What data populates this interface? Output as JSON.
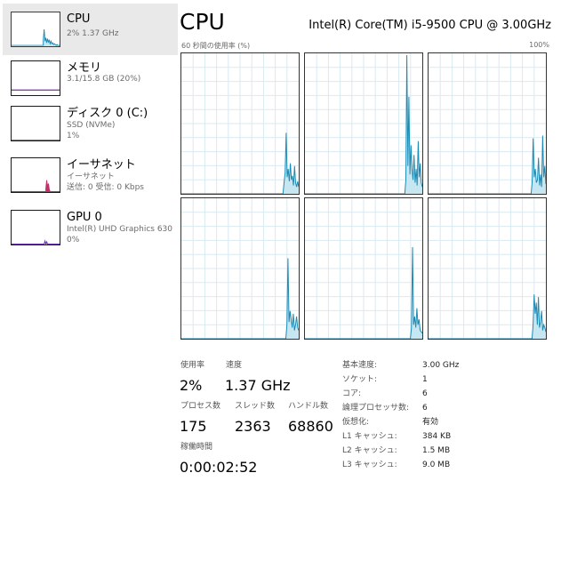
{
  "sidebar": {
    "items": [
      {
        "title": "CPU",
        "sub1": "2%  1.37 GHz",
        "sub2": "",
        "sub3": ""
      },
      {
        "title": "メモリ",
        "sub1": "3.1/15.8 GB (20%)",
        "sub2": "",
        "sub3": ""
      },
      {
        "title": "ディスク 0 (C:)",
        "sub1": "SSD (NVMe)",
        "sub2": "1%",
        "sub3": ""
      },
      {
        "title": "イーサネット",
        "sub1": "イーサネット",
        "sub2": "送信: 0 受信: 0 Kbps",
        "sub3": ""
      },
      {
        "title": "GPU 0",
        "sub1": "Intel(R) UHD Graphics 630",
        "sub2": "0%",
        "sub3": ""
      }
    ]
  },
  "header": {
    "title": "CPU",
    "model": "Intel(R) Core(TM) i5-9500 CPU @ 3.00GHz",
    "graph_caption": "60 秒間の使用率 (%)",
    "graph_max": "100%"
  },
  "stats": {
    "utilization_label": "使用率",
    "utilization": "2%",
    "speed_label": "速度",
    "speed": "1.37 GHz",
    "processes_label": "プロセス数",
    "processes": "175",
    "threads_label": "スレッド数",
    "threads": "2363",
    "handles_label": "ハンドル数",
    "handles": "68860",
    "uptime_label": "稼働時間",
    "uptime": "0:00:02:52"
  },
  "specs": [
    {
      "key": "基本速度:",
      "value": "3.00 GHz"
    },
    {
      "key": "ソケット:",
      "value": "1"
    },
    {
      "key": "コア:",
      "value": "6"
    },
    {
      "key": "論理プロセッサ数:",
      "value": "6"
    },
    {
      "key": "仮想化:",
      "value": "有効"
    },
    {
      "key": "L1 キャッシュ:",
      "value": "384 KB"
    },
    {
      "key": "L2 キャッシュ:",
      "value": "1.5 MB"
    },
    {
      "key": "L3 キャッシュ:",
      "value": "9.0 MB"
    }
  ],
  "colors": {
    "cpu_line": "#1e8bb4",
    "cpu_fill": "#c6e6f2",
    "memory_line": "#8b3fa8",
    "disk_line": "#4da033",
    "ethernet_line": "#c0306b",
    "gpu_line": "#6e3fb0",
    "grid": "#d9eaf2"
  },
  "core_graphs": [
    {
      "name": "cpu-core-0",
      "samples": [
        0,
        0,
        0,
        0,
        0,
        0,
        0,
        0,
        0,
        0,
        0,
        0,
        0,
        0,
        0,
        0,
        0,
        0,
        0,
        0,
        0,
        0,
        0,
        0,
        0,
        0,
        0,
        0,
        0,
        0,
        0,
        0,
        0,
        0,
        0,
        0,
        0,
        0,
        0,
        0,
        0,
        0,
        0,
        0,
        0,
        0,
        0,
        0,
        0,
        0,
        0,
        0,
        0,
        0,
        0,
        0,
        0,
        0,
        0,
        0,
        0,
        0,
        0,
        0,
        0,
        0,
        0,
        0,
        0,
        0,
        0,
        0,
        0,
        0,
        0,
        0,
        0,
        0,
        0,
        0,
        0,
        0,
        0,
        0,
        0,
        0,
        0,
        0,
        0,
        0,
        0,
        0,
        0,
        0,
        0,
        0,
        0,
        0,
        8,
        15,
        44,
        12,
        18,
        9,
        22,
        10,
        13,
        6,
        20,
        8,
        5,
        9,
        5
      ]
    },
    {
      "name": "cpu-core-1",
      "samples": [
        0,
        0,
        0,
        0,
        0,
        0,
        0,
        0,
        0,
        0,
        0,
        0,
        0,
        0,
        0,
        0,
        0,
        0,
        0,
        0,
        0,
        0,
        0,
        0,
        0,
        0,
        0,
        0,
        0,
        0,
        0,
        0,
        0,
        0,
        0,
        0,
        0,
        0,
        0,
        0,
        0,
        0,
        0,
        0,
        0,
        0,
        0,
        0,
        0,
        0,
        0,
        0,
        0,
        0,
        0,
        0,
        0,
        0,
        0,
        0,
        0,
        0,
        0,
        0,
        0,
        0,
        0,
        0,
        0,
        0,
        0,
        0,
        0,
        0,
        0,
        0,
        0,
        0,
        0,
        0,
        0,
        0,
        0,
        0,
        0,
        0,
        0,
        0,
        0,
        0,
        0,
        0,
        0,
        0,
        0,
        0,
        0,
        0,
        10,
        100,
        20,
        70,
        14,
        35,
        18,
        10,
        28,
        8,
        18,
        6,
        38,
        12,
        22,
        8,
        5
      ]
    },
    {
      "name": "cpu-core-2",
      "samples": [
        0,
        0,
        0,
        0,
        0,
        0,
        0,
        0,
        0,
        0,
        0,
        0,
        0,
        0,
        0,
        0,
        0,
        0,
        0,
        0,
        0,
        0,
        0,
        0,
        0,
        0,
        0,
        0,
        0,
        0,
        0,
        0,
        0,
        0,
        0,
        0,
        0,
        0,
        0,
        0,
        0,
        0,
        0,
        0,
        0,
        0,
        0,
        0,
        0,
        0,
        0,
        0,
        0,
        0,
        0,
        0,
        0,
        0,
        0,
        0,
        0,
        0,
        0,
        0,
        0,
        0,
        0,
        0,
        0,
        0,
        0,
        0,
        0,
        0,
        0,
        0,
        0,
        0,
        0,
        0,
        0,
        0,
        0,
        0,
        0,
        0,
        0,
        0,
        0,
        0,
        0,
        0,
        0,
        0,
        0,
        0,
        0,
        0,
        8,
        40,
        12,
        18,
        8,
        10,
        26,
        6,
        14,
        5,
        42,
        12,
        20,
        7
      ]
    },
    {
      "name": "cpu-core-3",
      "samples": [
        0,
        0,
        0,
        0,
        0,
        0,
        0,
        0,
        0,
        0,
        0,
        0,
        0,
        0,
        0,
        0,
        0,
        0,
        0,
        0,
        0,
        0,
        0,
        0,
        0,
        0,
        0,
        0,
        0,
        0,
        0,
        0,
        0,
        0,
        0,
        0,
        0,
        0,
        0,
        0,
        0,
        0,
        0,
        0,
        0,
        0,
        0,
        0,
        0,
        0,
        0,
        0,
        0,
        0,
        0,
        0,
        0,
        0,
        0,
        0,
        0,
        0,
        0,
        0,
        0,
        0,
        0,
        0,
        0,
        0,
        0,
        0,
        0,
        0,
        0,
        0,
        0,
        0,
        0,
        0,
        0,
        0,
        0,
        0,
        0,
        0,
        0,
        0,
        0,
        0,
        0,
        0,
        0,
        0,
        0,
        0,
        0,
        0,
        10,
        58,
        12,
        20,
        14,
        8,
        18,
        6,
        10,
        16,
        8,
        6
      ]
    },
    {
      "name": "cpu-core-4",
      "samples": [
        0,
        0,
        0,
        0,
        0,
        0,
        0,
        0,
        0,
        0,
        0,
        0,
        0,
        0,
        0,
        0,
        0,
        0,
        0,
        0,
        0,
        0,
        0,
        0,
        0,
        0,
        0,
        0,
        0,
        0,
        0,
        0,
        0,
        0,
        0,
        0,
        0,
        0,
        0,
        0,
        0,
        0,
        0,
        0,
        0,
        0,
        0,
        0,
        0,
        0,
        0,
        0,
        0,
        0,
        0,
        0,
        0,
        0,
        0,
        0,
        0,
        0,
        0,
        0,
        0,
        0,
        0,
        0,
        0,
        0,
        0,
        0,
        0,
        0,
        0,
        0,
        0,
        0,
        0,
        0,
        0,
        0,
        0,
        0,
        0,
        0,
        0,
        0,
        0,
        0,
        0,
        0,
        0,
        0,
        0,
        0,
        0,
        0,
        8,
        66,
        10,
        16,
        8,
        22,
        10,
        14,
        6,
        5,
        4
      ]
    },
    {
      "name": "cpu-core-5",
      "samples": [
        0,
        0,
        0,
        0,
        0,
        0,
        0,
        0,
        0,
        0,
        0,
        0,
        0,
        0,
        0,
        0,
        0,
        0,
        0,
        0,
        0,
        0,
        0,
        0,
        0,
        0,
        0,
        0,
        0,
        0,
        0,
        0,
        0,
        0,
        0,
        0,
        0,
        0,
        0,
        0,
        0,
        0,
        0,
        0,
        0,
        0,
        0,
        0,
        0,
        0,
        0,
        0,
        0,
        0,
        0,
        0,
        0,
        0,
        0,
        0,
        0,
        0,
        0,
        0,
        0,
        0,
        0,
        0,
        0,
        0,
        0,
        0,
        0,
        0,
        0,
        0,
        0,
        0,
        0,
        0,
        0,
        0,
        0,
        0,
        0,
        0,
        0,
        0,
        0,
        0,
        0,
        0,
        0,
        0,
        0,
        0,
        0,
        0,
        10,
        32,
        18,
        26,
        10,
        30,
        8,
        12,
        20,
        6,
        10,
        8,
        5
      ]
    }
  ]
}
